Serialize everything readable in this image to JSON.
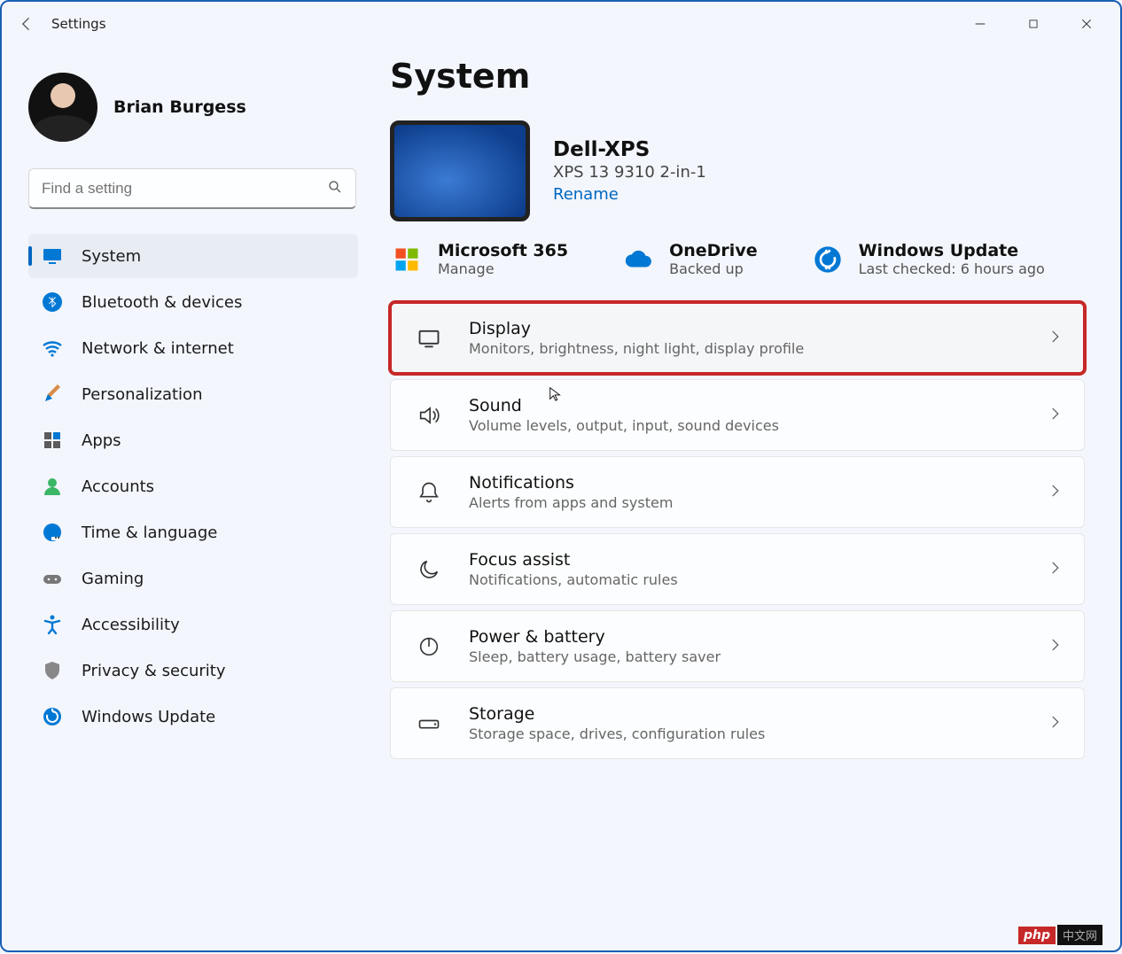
{
  "app": {
    "title": "Settings"
  },
  "user": {
    "name": "Brian Burgess"
  },
  "search": {
    "placeholder": "Find a setting"
  },
  "nav": {
    "items": [
      {
        "label": "System",
        "icon": "system",
        "active": true
      },
      {
        "label": "Bluetooth & devices",
        "icon": "bluetooth"
      },
      {
        "label": "Network & internet",
        "icon": "wifi"
      },
      {
        "label": "Personalization",
        "icon": "brush"
      },
      {
        "label": "Apps",
        "icon": "apps"
      },
      {
        "label": "Accounts",
        "icon": "person"
      },
      {
        "label": "Time & language",
        "icon": "globe"
      },
      {
        "label": "Gaming",
        "icon": "gamepad"
      },
      {
        "label": "Accessibility",
        "icon": "accessibility"
      },
      {
        "label": "Privacy & security",
        "icon": "shield"
      },
      {
        "label": "Windows Update",
        "icon": "update"
      }
    ]
  },
  "page": {
    "title": "System"
  },
  "device": {
    "name": "Dell-XPS",
    "model": "XPS 13 9310 2-in-1",
    "rename_label": "Rename"
  },
  "status": {
    "ms365": {
      "title": "Microsoft 365",
      "sub": "Manage"
    },
    "onedrive": {
      "title": "OneDrive",
      "sub": "Backed up"
    },
    "update": {
      "title": "Windows Update",
      "sub": "Last checked: 6 hours ago"
    }
  },
  "cards": [
    {
      "title": "Display",
      "sub": "Monitors, brightness, night light, display profile",
      "icon": "display",
      "highlighted": true
    },
    {
      "title": "Sound",
      "sub": "Volume levels, output, input, sound devices",
      "icon": "sound"
    },
    {
      "title": "Notifications",
      "sub": "Alerts from apps and system",
      "icon": "bell"
    },
    {
      "title": "Focus assist",
      "sub": "Notifications, automatic rules",
      "icon": "moon"
    },
    {
      "title": "Power & battery",
      "sub": "Sleep, battery usage, battery saver",
      "icon": "power"
    },
    {
      "title": "Storage",
      "sub": "Storage space, drives, configuration rules",
      "icon": "storage"
    }
  ],
  "watermark": {
    "a": "php",
    "b": "中文网"
  }
}
